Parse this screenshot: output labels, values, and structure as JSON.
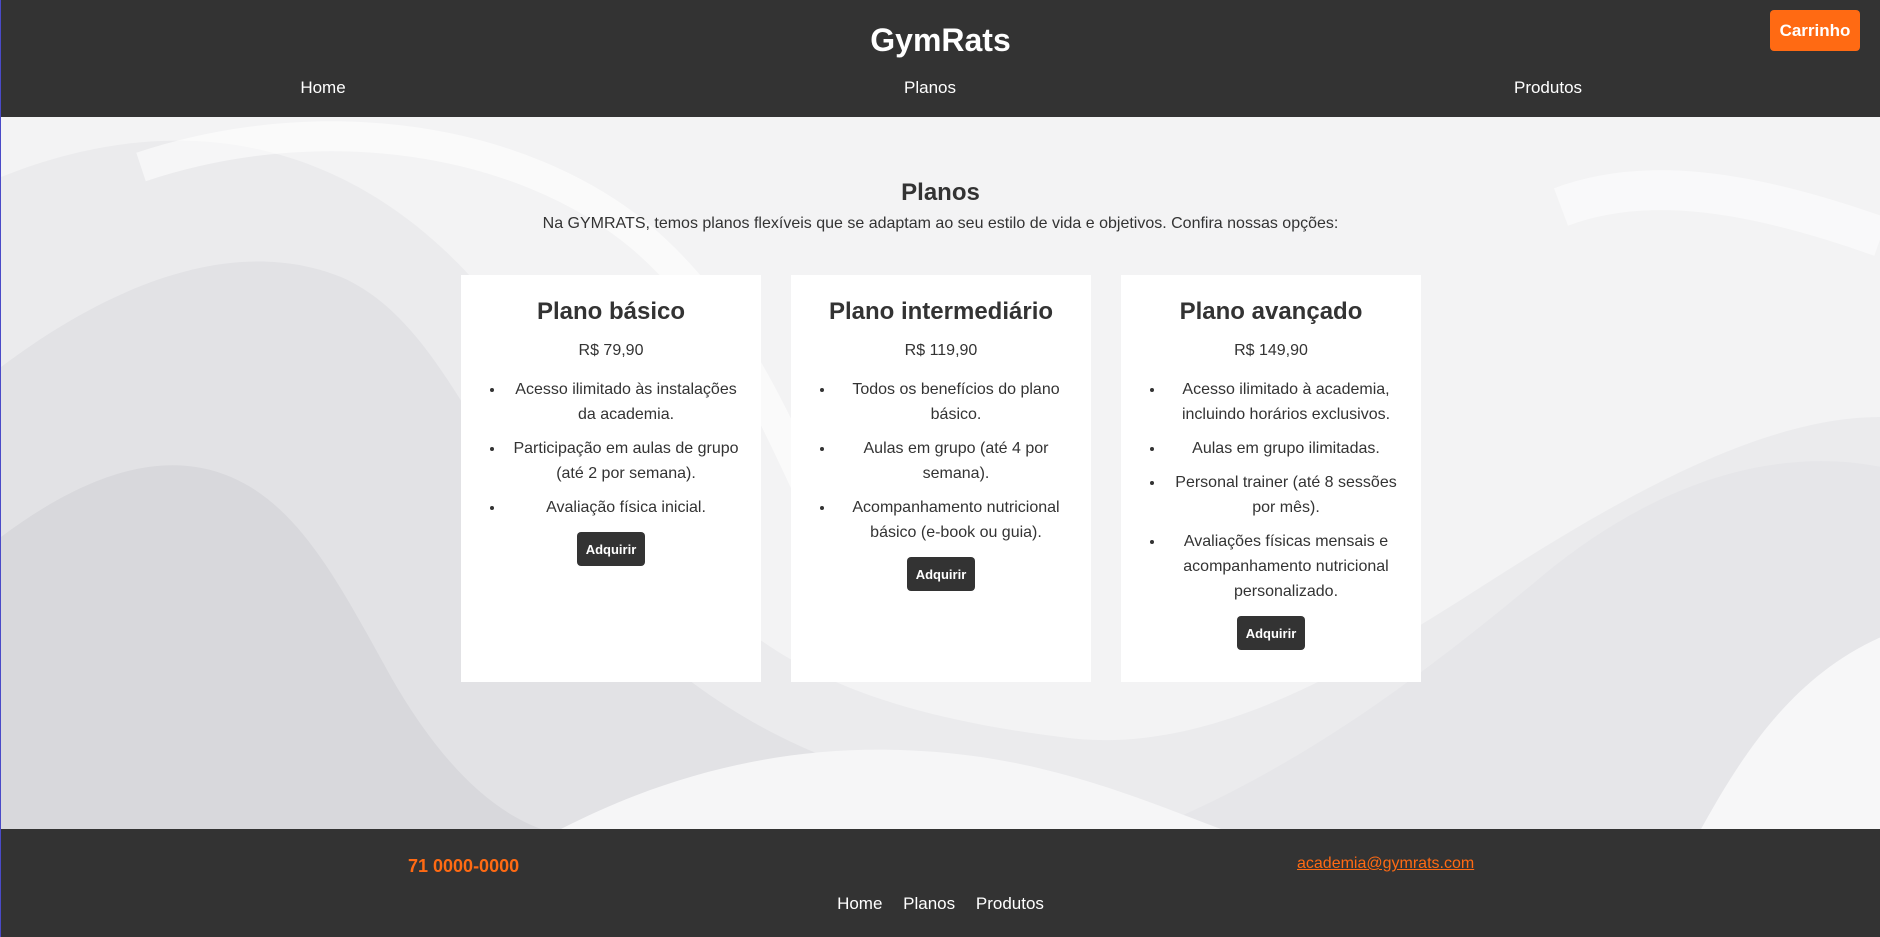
{
  "header": {
    "brand": "GymRats",
    "cart_label": "Carrinho",
    "nav": [
      "Home",
      "Planos",
      "Produtos"
    ]
  },
  "plans_section": {
    "title": "Planos",
    "intro": "Na GYMRATS, temos planos flexíveis que se adaptam ao seu estilo de vida e objetivos. Confira nossas opções:",
    "plans": [
      {
        "name": "Plano básico",
        "price": "R$ 79,90",
        "features": [
          "Acesso ilimitado às instalações da academia.",
          "Participação em aulas de grupo (até 2 por semana).",
          "Avaliação física inicial."
        ],
        "button": "Adquirir"
      },
      {
        "name": "Plano intermediário",
        "price": "R$ 119,90",
        "features": [
          "Todos os benefícios do plano básico.",
          "Aulas em grupo (até 4 por semana).",
          "Acompanhamento nutricional básico (e-book ou guia)."
        ],
        "button": "Adquirir"
      },
      {
        "name": "Plano avançado",
        "price": "R$ 149,90",
        "features": [
          "Acesso ilimitado à academia, incluindo horários exclusivos.",
          "Aulas em grupo ilimitadas.",
          "Personal trainer (até 8 sessões por mês).",
          "Avaliações físicas mensais e acompanhamento nutricional personalizado."
        ],
        "button": "Adquirir"
      }
    ]
  },
  "footer": {
    "phone": "71 0000-0000",
    "email": "academia@gymrats.com",
    "nav": [
      "Home",
      "Planos",
      "Produtos"
    ]
  },
  "colors": {
    "dark": "#333333",
    "accent": "#ff6a13",
    "card": "#ffffff",
    "background": "#e9e9eb"
  }
}
